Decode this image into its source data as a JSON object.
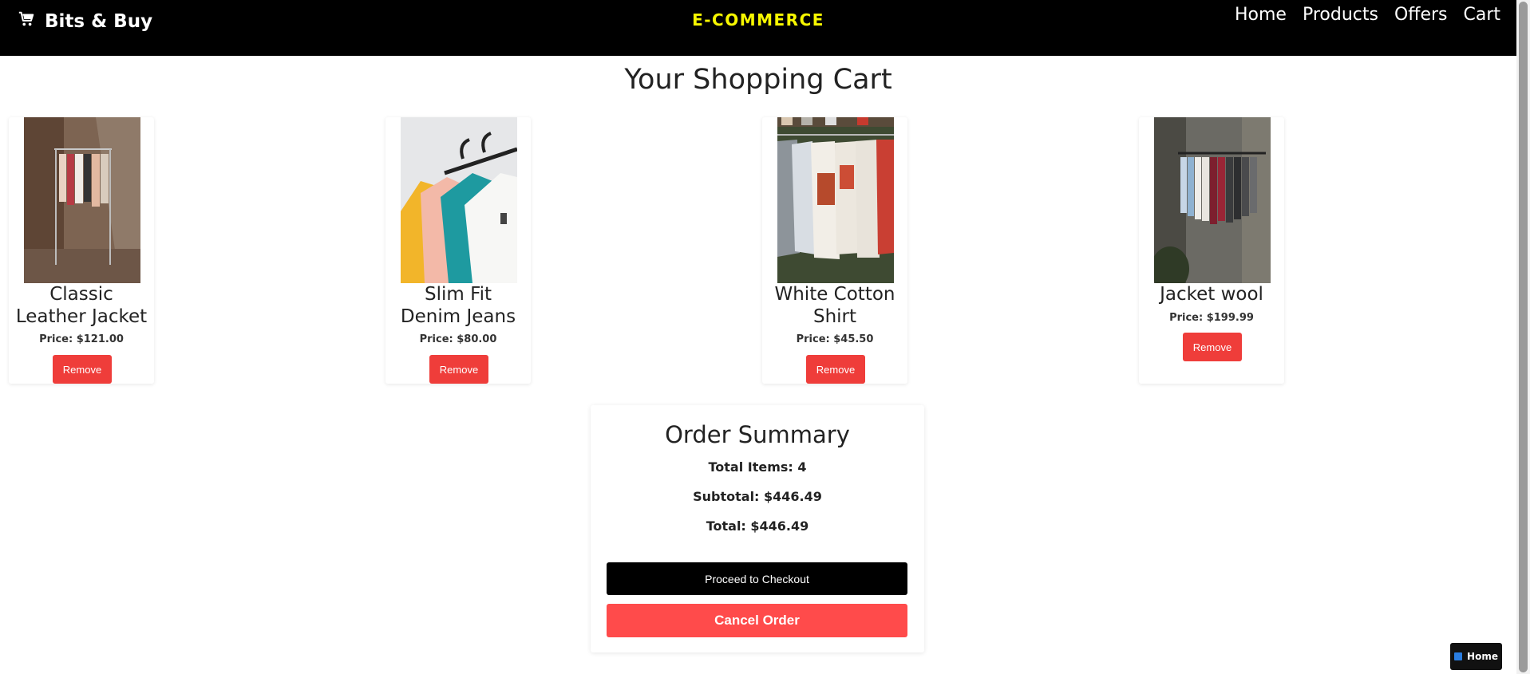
{
  "header": {
    "brand": "Bits & Buy",
    "center_title": "E-COMMERCE",
    "nav": [
      "Home",
      "Products",
      "Offers",
      "Cart"
    ]
  },
  "page_title": "Your Shopping Cart",
  "cart_items": [
    {
      "name": "Classic Leather Jacket",
      "price": "Price: $121.00",
      "remove_label": "Remove"
    },
    {
      "name": "Slim Fit Denim Jeans",
      "price": "Price: $80.00",
      "remove_label": "Remove"
    },
    {
      "name": "White Cotton Shirt",
      "price": "Price: $45.50",
      "remove_label": "Remove"
    },
    {
      "name": "Jacket wool",
      "price": "Price: $199.99",
      "remove_label": "Remove"
    }
  ],
  "summary": {
    "title": "Order Summary",
    "total_items": "Total Items: 4",
    "subtotal": "Subtotal: $446.49",
    "total": "Total: $446.49",
    "checkout_label": "Proceed to Checkout",
    "cancel_label": "Cancel Order"
  },
  "floating_button": {
    "label": "Home"
  },
  "colors": {
    "header_bg": "#000000",
    "center_title": "#f7f700",
    "remove_btn": "#ef3d3a",
    "cancel_btn": "#ff4b4b",
    "checkout_btn": "#000000"
  }
}
